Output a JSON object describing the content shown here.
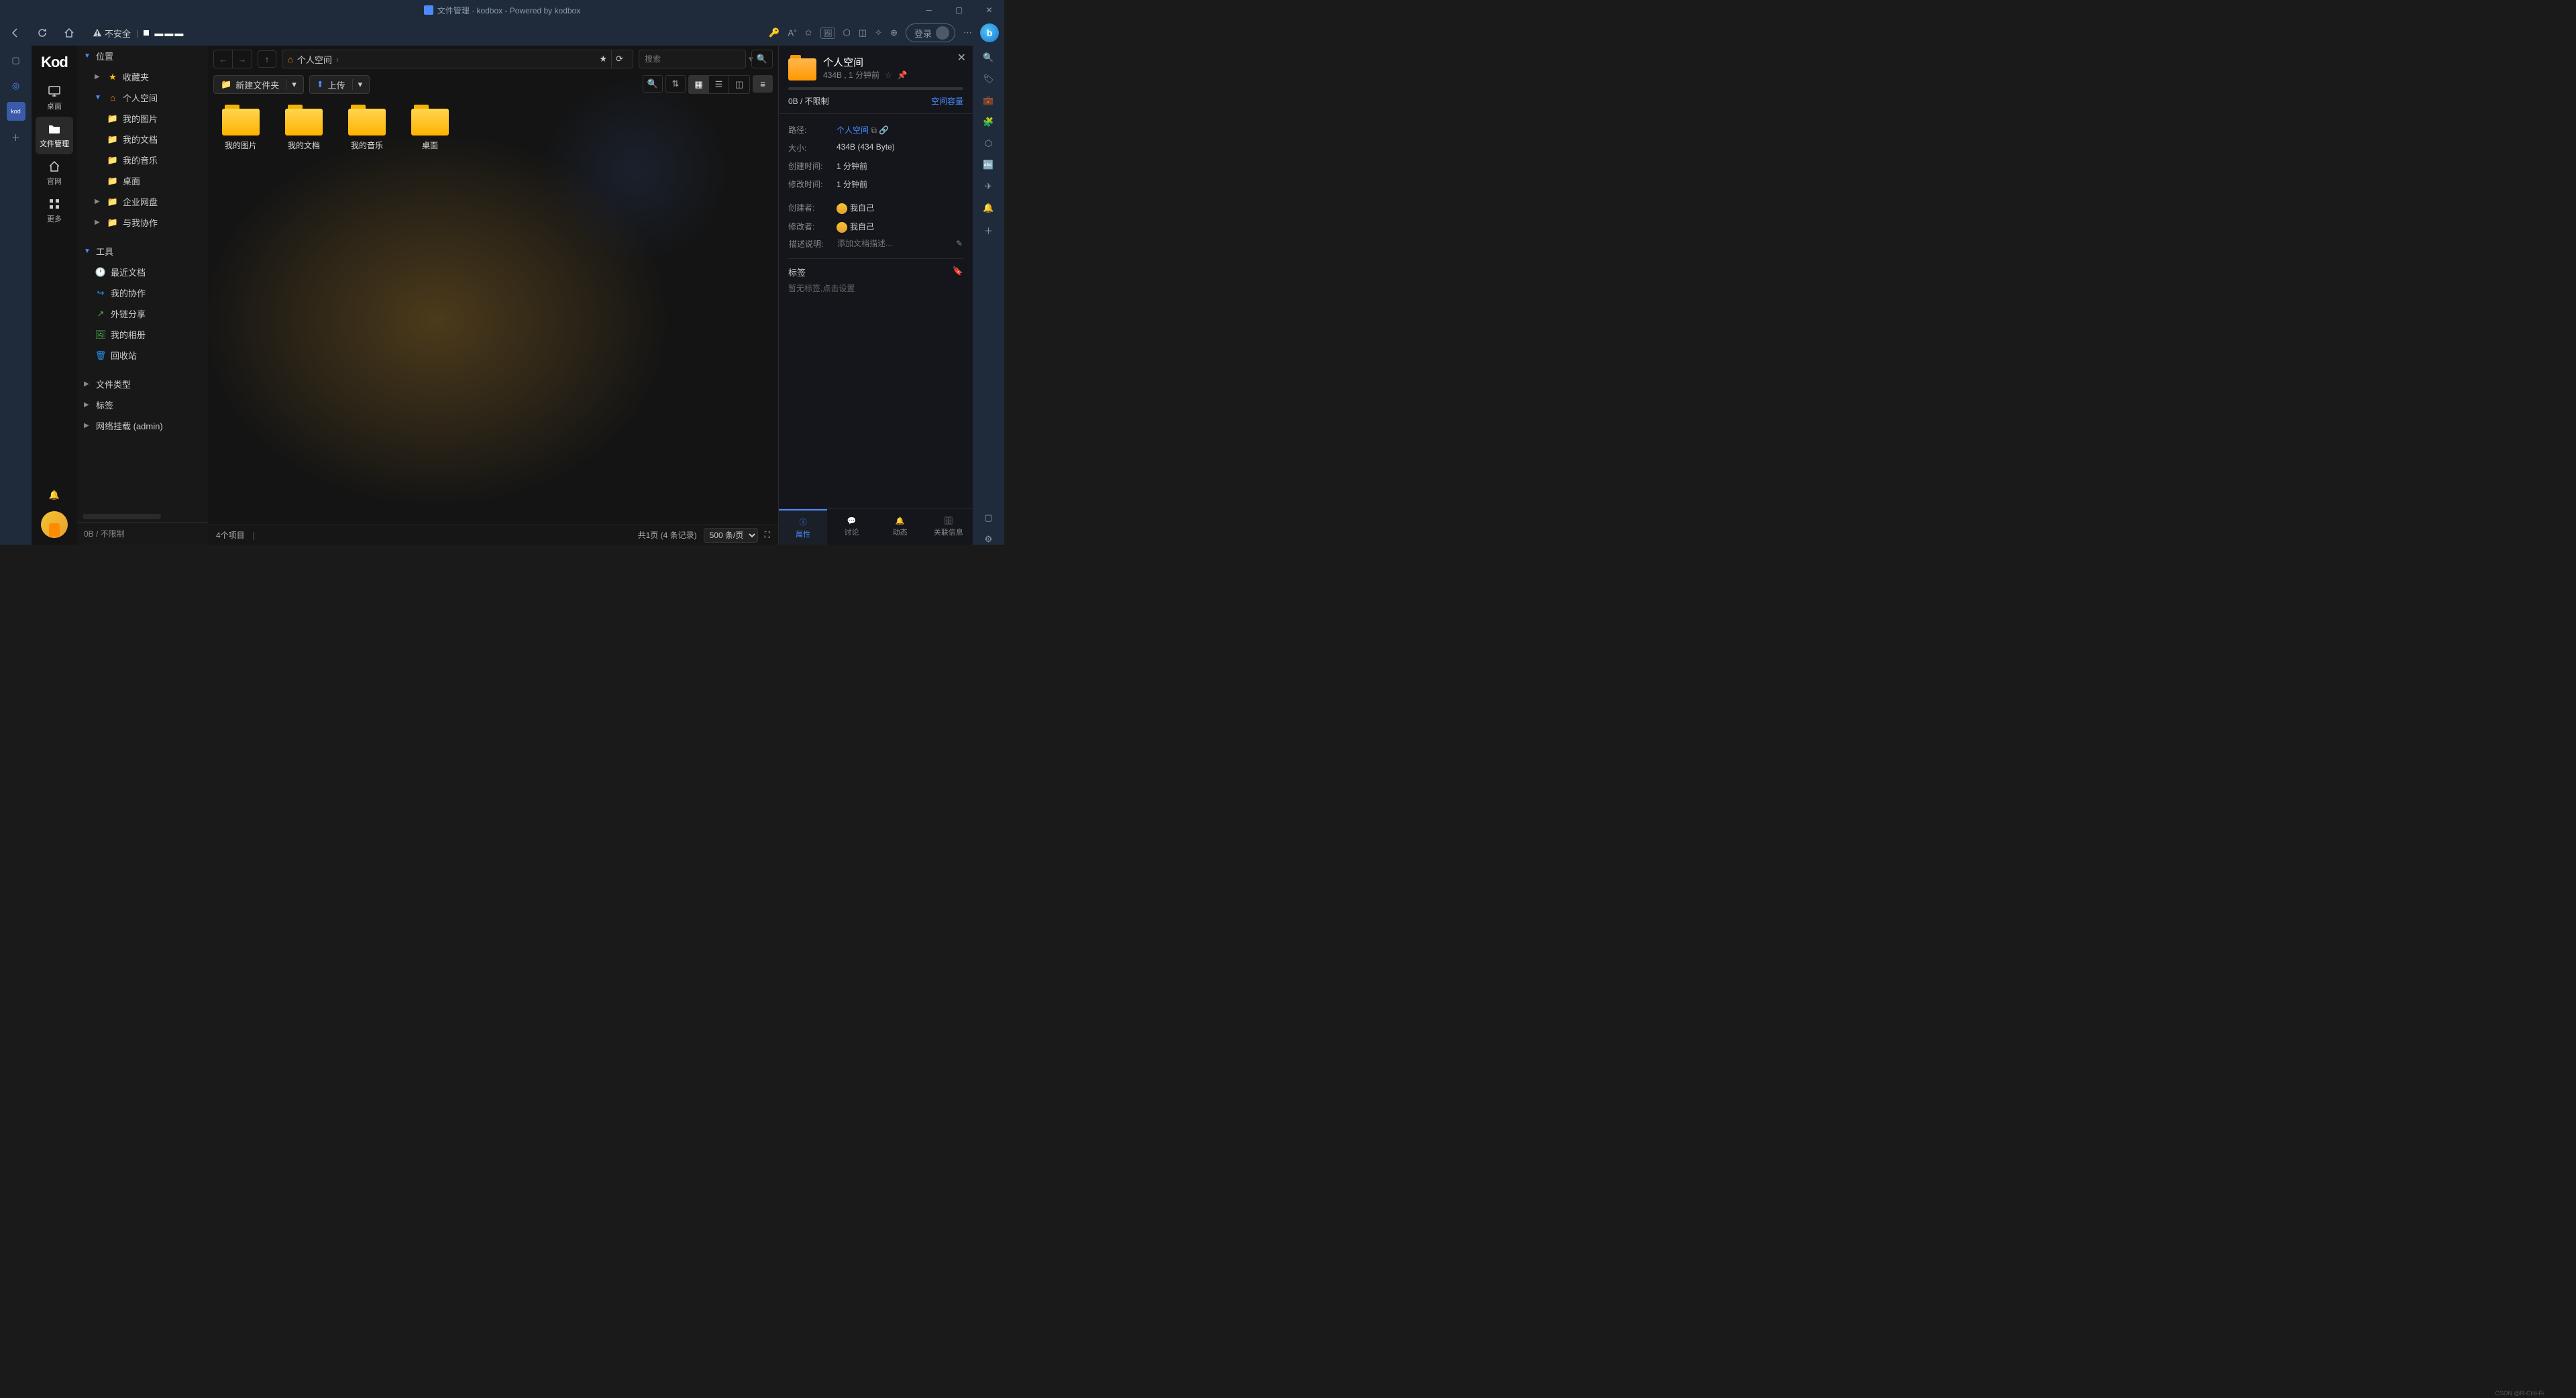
{
  "window": {
    "title": "文件管理 · kodbox - Powered by kodbox"
  },
  "browser": {
    "insecure": "不安全",
    "url_mask": "▬▬▬",
    "login": "登录",
    "addr_sep": "|"
  },
  "rail": {
    "logo": "Kod",
    "items": [
      {
        "icon": "monitor",
        "label": "桌面"
      },
      {
        "icon": "folder",
        "label": "文件管理"
      },
      {
        "icon": "home",
        "label": "官网"
      },
      {
        "icon": "grid",
        "label": "更多"
      }
    ]
  },
  "tree": {
    "root_label": "位置",
    "favorites": "收藏夹",
    "personal": "个人空间",
    "personal_children": [
      "我的图片",
      "我的文档",
      "我的音乐",
      "桌面"
    ],
    "enterprise": "企业网盘",
    "collab": "与我协作",
    "tools": "工具",
    "tool_items": [
      {
        "icon": "clock",
        "label": "最近文档",
        "color": "#2196f3"
      },
      {
        "icon": "share",
        "label": "我的协作",
        "color": "#2196f3"
      },
      {
        "icon": "link",
        "label": "外链分享",
        "color": "#4caf50"
      },
      {
        "icon": "image",
        "label": "我的相册",
        "color": "#4caf50"
      },
      {
        "icon": "trash",
        "label": "回收站",
        "color": "#2196f3"
      }
    ],
    "filetype": "文件类型",
    "tags": "标签",
    "mount": "网络挂载 (admin)",
    "quota": "0B / 不限制"
  },
  "toolbar": {
    "breadcrumb": "个人空间",
    "search_placeholder": "搜索",
    "new_folder": "新建文件夹",
    "upload": "上传"
  },
  "folders": [
    "我的图片",
    "我的文档",
    "我的音乐",
    "桌面"
  ],
  "status": {
    "count": "4个项目",
    "page": "共1页 (4 条记录)",
    "per_page": "500 条/页"
  },
  "info": {
    "title": "个人空间",
    "subtitle": "434B , 1 分钟前",
    "used": "0B / 不限制",
    "capacity_link": "空间容量",
    "fields": {
      "path_label": "路径:",
      "path_value": "个人空间",
      "size_label": "大小:",
      "size_value": "434B (434 Byte)",
      "ctime_label": "创建时间:",
      "ctime_value": "1 分钟前",
      "mtime_label": "修改时间:",
      "mtime_value": "1 分钟前",
      "creator_label": "创建者:",
      "creator_value": "我自己",
      "modifier_label": "修改者:",
      "modifier_value": "我自己",
      "desc_label": "描述说明:",
      "desc_placeholder": "添加文档描述..."
    },
    "tags_label": "标签",
    "tags_empty": "暂无标签,点击设置",
    "tabs": [
      "属性",
      "讨论",
      "动态",
      "关联信息"
    ]
  },
  "watermark": "CSDN @R-CHI-Fi"
}
